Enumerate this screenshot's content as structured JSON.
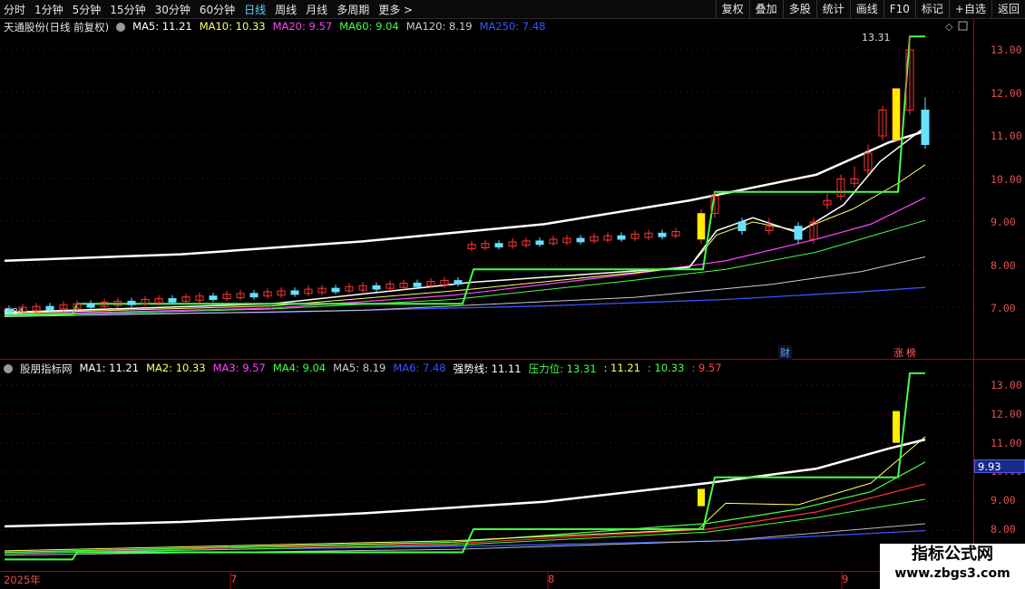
{
  "toolbar": {
    "periods": [
      "分时",
      "1分钟",
      "5分钟",
      "15分钟",
      "30分钟",
      "60分钟",
      "日线",
      "周线",
      "月线",
      "多周期",
      "更多 >"
    ],
    "active": "日线",
    "right": [
      "复权",
      "叠加",
      "多股",
      "统计",
      "画线",
      "F10",
      "标记",
      "+自选",
      "返回"
    ]
  },
  "main": {
    "stock": "天通股份(日线 前复权)",
    "ma": [
      {
        "label": "MA5: 11.21",
        "color": "#ffffff"
      },
      {
        "label": "MA10: 10.33",
        "color": "#ffff66"
      },
      {
        "label": "MA20: 9.57",
        "color": "#ff44ff"
      },
      {
        "label": "MA60: 9.04",
        "color": "#44ff44"
      },
      {
        "label": "MA120: 8.19",
        "color": "#cccccc"
      },
      {
        "label": "MA250: 7.48",
        "color": "#3a55ff"
      }
    ],
    "yticks": [
      "13.00",
      "12.00",
      "11.00",
      "10.00",
      "9.00",
      "8.00",
      "7.00"
    ],
    "high_label": "13.31",
    "low_label": "6.84",
    "tags": [
      "财",
      "涨",
      "榜"
    ]
  },
  "sub": {
    "name": "股朋指标网",
    "ma": [
      {
        "label": "MA1: 11.21",
        "color": "#ffffff"
      },
      {
        "label": "MA2: 10.33",
        "color": "#ffff66"
      },
      {
        "label": "MA3: 9.57",
        "color": "#ff44ff"
      },
      {
        "label": "MA4: 9.04",
        "color": "#44ff44"
      },
      {
        "label": "MA5: 8.19",
        "color": "#cccccc"
      },
      {
        "label": "MA6: 7.48",
        "color": "#3a55ff"
      },
      {
        "label": "强势线: 11.11",
        "color": "#ffffff"
      },
      {
        "label": "压力位: 13.31",
        "color": "#44ff44"
      },
      {
        "label": ": 11.21",
        "color": "#ffff66"
      },
      {
        "label": ": 10.33",
        "color": "#44ff44"
      },
      {
        "label": ": 9.57",
        "color": "#ff4444"
      }
    ],
    "yticks": [
      "13.00",
      "12.00",
      "11.00",
      "10.00",
      "9.00",
      "8.00"
    ],
    "cursor_value": "9.93"
  },
  "xaxis": [
    "2025年",
    "7",
    "8",
    "9"
  ],
  "watermark": {
    "line1": "指标公式网",
    "line2": "www.zbgs3.com"
  }
}
